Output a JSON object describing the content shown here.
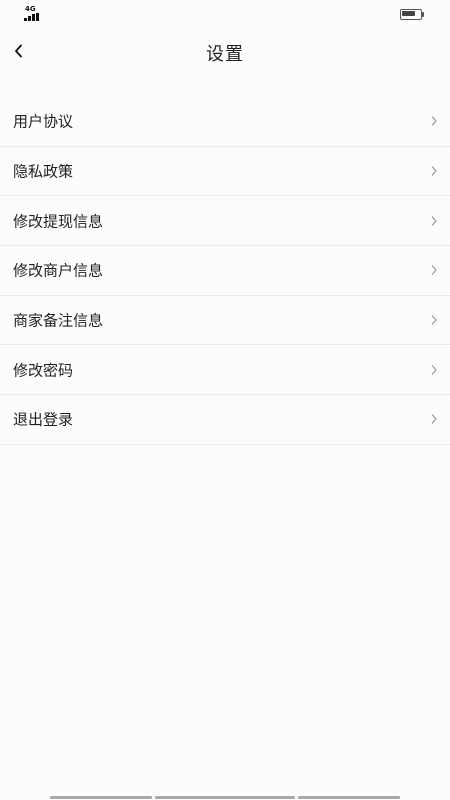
{
  "status_bar": {
    "network_label": "4G",
    "battery_level": 0.7
  },
  "nav": {
    "title": "设置",
    "back_icon": "chevron-left-icon"
  },
  "menu": {
    "items": [
      {
        "label": "用户协议"
      },
      {
        "label": "隐私政策"
      },
      {
        "label": "修改提现信息"
      },
      {
        "label": "修改商户信息"
      },
      {
        "label": "商家备注信息"
      },
      {
        "label": "修改密码"
      },
      {
        "label": "退出登录"
      }
    ],
    "chevron_icon": "chevron-right-icon"
  },
  "colors": {
    "background": "#fcfcfc",
    "divider": "#ebebeb",
    "text": "#222222",
    "chevron": "#999999"
  }
}
